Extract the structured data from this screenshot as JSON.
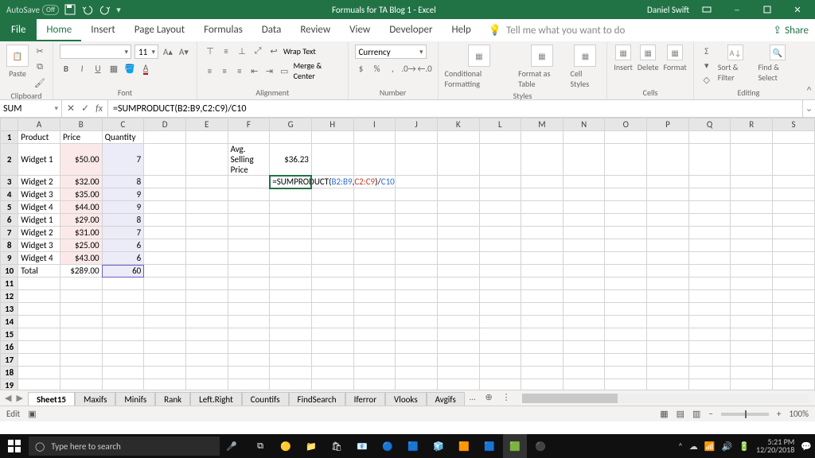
{
  "titlebar": {
    "autosave": "AutoSave",
    "autosave_state": "Off",
    "title": "Formuals for TA Blog 1  -  Excel",
    "user": "Daniel Swift"
  },
  "ribbon_tabs": [
    "File",
    "Home",
    "Insert",
    "Page Layout",
    "Formulas",
    "Data",
    "Review",
    "View",
    "Developer",
    "Help"
  ],
  "ribbon_active": "Home",
  "tellme": "Tell me what you want to do",
  "share": "Share",
  "group_labels": {
    "clipboard": "Clipboard",
    "font": "Font",
    "alignment": "Alignment",
    "number": "Number",
    "styles": "Styles",
    "cells": "Cells",
    "editing": "Editing"
  },
  "ribbon_items": {
    "paste": "Paste",
    "font_size": "11",
    "wrap": "Wrap Text",
    "merge": "Merge & Center",
    "number_format": "Currency",
    "conditional": "Conditional Formatting",
    "format_table": "Format as Table",
    "cell_styles": "Cell Styles",
    "insert": "Insert",
    "delete": "Delete",
    "format": "Format",
    "sort": "Sort & Filter",
    "find": "Find & Select"
  },
  "namebox": "SUM",
  "formula": "=SUMPRODUCT(B2:B9,C2:C9)/C10",
  "columns": [
    "A",
    "B",
    "C",
    "D",
    "E",
    "F",
    "G",
    "H",
    "I",
    "J",
    "K",
    "L",
    "M",
    "N",
    "O",
    "P",
    "Q",
    "R",
    "S"
  ],
  "row_count": 21,
  "headers": {
    "a": "Product",
    "b": "Price",
    "c": "Quantity"
  },
  "data_rows": [
    {
      "a": "Widget 1",
      "b": "$50.00",
      "c": "7"
    },
    {
      "a": "Widget 2",
      "b": "$32.00",
      "c": "8"
    },
    {
      "a": "Widget 3",
      "b": "$35.00",
      "c": "9"
    },
    {
      "a": "Widget 4",
      "b": "$44.00",
      "c": "9"
    },
    {
      "a": "Widget 1",
      "b": "$29.00",
      "c": "8"
    },
    {
      "a": "Widget 2",
      "b": "$31.00",
      "c": "7"
    },
    {
      "a": "Widget 3",
      "b": "$25.00",
      "c": "6"
    },
    {
      "a": "Widget 4",
      "b": "$43.00",
      "c": "6"
    }
  ],
  "totals": {
    "a": "Total",
    "b": "$289.00",
    "c": "60"
  },
  "avg_label": "Avg. Selling Price",
  "avg_value": "$36.23",
  "inplace_formula": {
    "fn": "=SUMPRODUCT(",
    "r1": "B2:B9",
    "sep": ",",
    "r2": "C2:C9",
    "mid": ")/",
    "r3": "C10"
  },
  "sheet_tabs": [
    "Sheet15",
    "Maxifs",
    "Minifs",
    "Rank",
    "Left.Right",
    "Countifs",
    "FindSearch",
    "Iferror",
    "Vlooks",
    "Avgifs"
  ],
  "sheet_active": "Sheet15",
  "status_mode": "Edit",
  "zoom": "100%",
  "taskbar": {
    "search": "Type here to search",
    "time": "5:21 PM",
    "date": "12/20/2018"
  }
}
